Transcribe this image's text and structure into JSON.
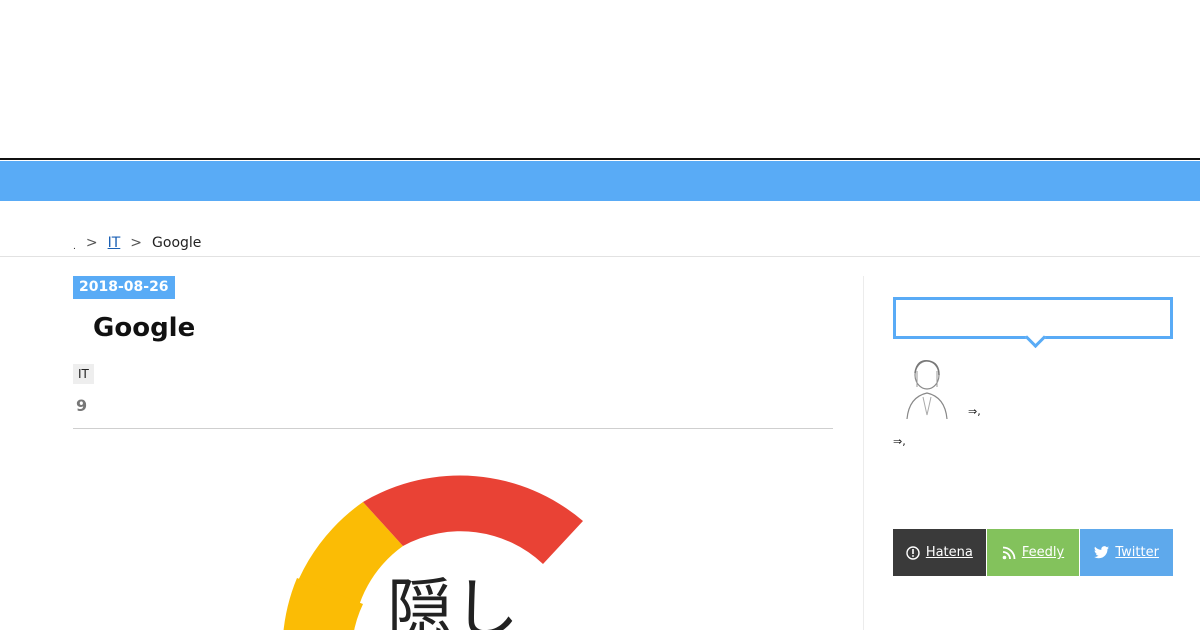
{
  "breadcrumb": {
    "home_label": ".",
    "separator": ">",
    "category_label": "IT",
    "current_label": "Google"
  },
  "post": {
    "date": "2018-08-26",
    "title": "Google",
    "tag": "IT",
    "count": "9"
  },
  "hero": {
    "text": "隠し"
  },
  "sidebar": {
    "arrow_text_1": "⇒,",
    "arrow_text_2": "⇒,"
  },
  "follow": {
    "hatena_label": "Hatena",
    "feedly_label": "Feedly",
    "twitter_label": "Twitter"
  },
  "colors": {
    "accent": "#59abf6",
    "hatena": "#3a3a3a",
    "feedly": "#83c25c",
    "twitter": "#5ea9ec",
    "hero_red": "#e94235",
    "hero_yellow": "#fbbc05"
  }
}
